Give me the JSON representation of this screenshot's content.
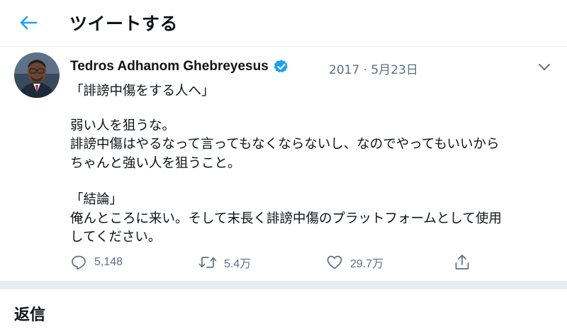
{
  "header": {
    "back_icon": "arrow-left-icon",
    "title": "ツイートする"
  },
  "tweet": {
    "author": {
      "name": "Tedros Adhanom Ghebreyesus",
      "verified": true,
      "avatar": "profile-photo"
    },
    "date": "2017 · 5月23日",
    "body_lines": [
      "「誹謗中傷をする人へ」",
      "弱い人を狙うな。",
      "誹謗中傷はやるなって言ってもなくならないし、なのでやってもいいから",
      "ちゃんと強い人を狙うこと。",
      "「結論」",
      "俺んところに来い。そして末長く誹謗中傷のプラットフォームとして使用",
      "してください。"
    ],
    "actions": {
      "reply": {
        "icon": "reply-icon",
        "count": "5,148"
      },
      "retweet": {
        "icon": "retweet-icon",
        "count": "5.4万"
      },
      "like": {
        "icon": "heart-icon",
        "count": "29.7万"
      },
      "share": {
        "icon": "share-icon"
      }
    }
  },
  "replies": {
    "title": "返信"
  },
  "colors": {
    "accent": "#1da1f2",
    "muted": "#5b7083",
    "divider": "#e6ecf0",
    "text": "#0f1419"
  }
}
